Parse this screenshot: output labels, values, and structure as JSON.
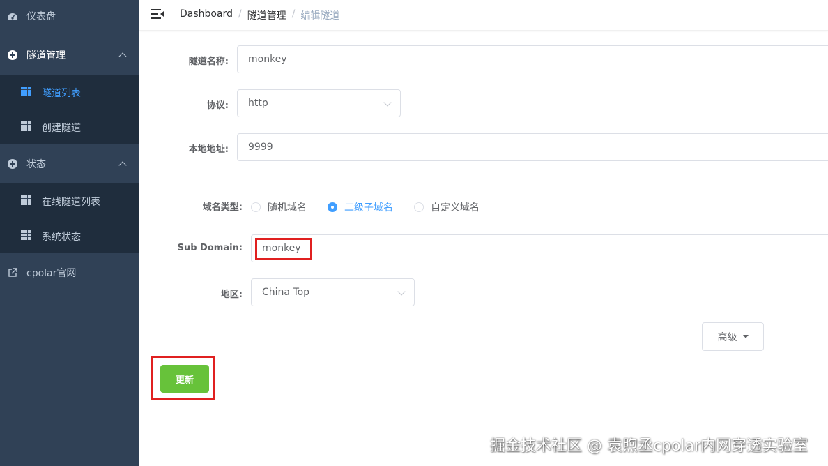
{
  "sidebar": {
    "dashboard_label": "仪表盘",
    "tunnel_mgmt_label": "隧道管理",
    "tunnel_list_label": "隧道列表",
    "create_tunnel_label": "创建隧道",
    "status_label": "状态",
    "online_tunnels_label": "在线隧道列表",
    "system_status_label": "系统状态",
    "cpolar_site_label": "cpolar官网",
    "active_color": "#409eff",
    "bg_color": "#304156"
  },
  "breadcrumb": {
    "items": [
      "Dashboard",
      "隧道管理",
      "编辑隧道"
    ],
    "separator": "/"
  },
  "form": {
    "tunnel_name_label": "隧道名称:",
    "tunnel_name_value": "monkey",
    "protocol_label": "协议:",
    "protocol_value": "http",
    "local_addr_label": "本地地址:",
    "local_addr_value": "9999",
    "domain_type_label": "域名类型:",
    "domain_type_options": [
      "随机域名",
      "二级子域名",
      "自定义域名"
    ],
    "domain_type_selected": "二级子域名",
    "subdomain_label": "Sub Domain:",
    "subdomain_value": "monkey",
    "region_label": "地区:",
    "region_value": "China Top",
    "advanced_label": "高级",
    "update_label": "更新",
    "update_color": "#67c23a"
  },
  "watermark": "掘金技术社区 @ 袁煦丞cpolar内网穿透实验室"
}
